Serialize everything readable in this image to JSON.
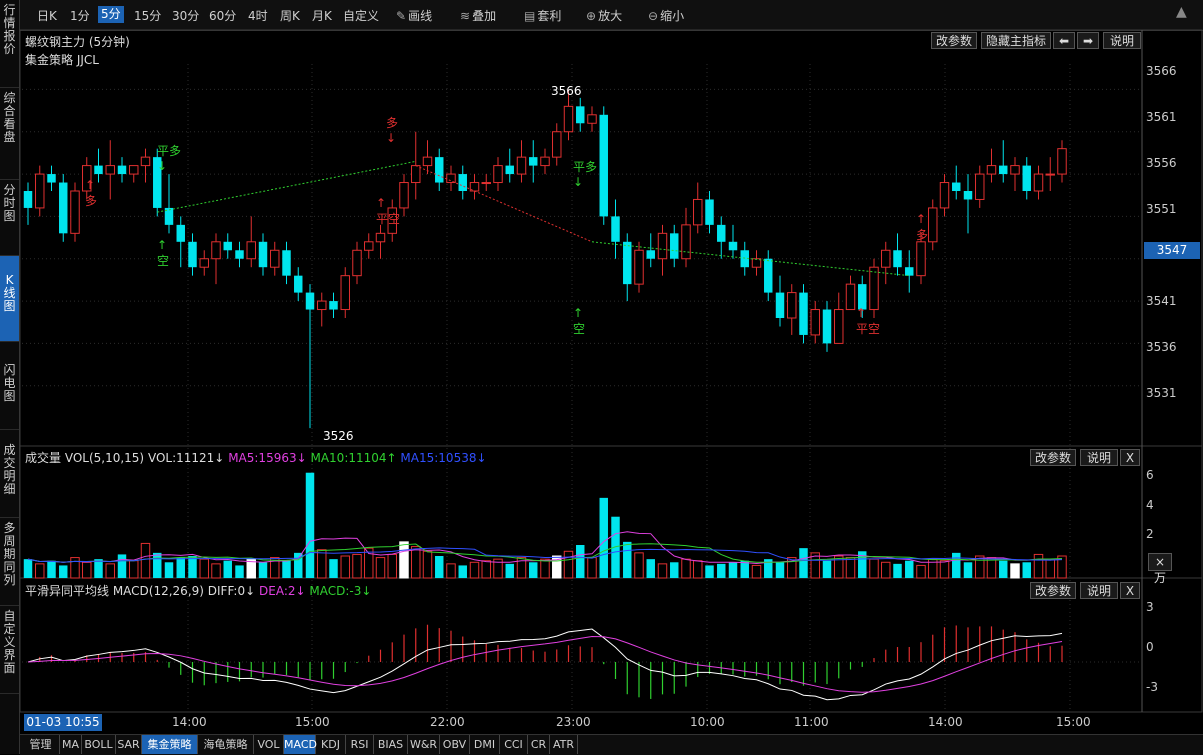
{
  "left_tabs": [
    {
      "label": "行情报价",
      "active": false
    },
    {
      "label": "综合看盘",
      "active": false
    },
    {
      "label": "分时图",
      "active": false
    },
    {
      "label": "K线图",
      "active": true
    },
    {
      "label": "闪电图",
      "active": false
    },
    {
      "label": "成交明细",
      "active": false
    },
    {
      "label": "多周期同列",
      "active": false
    },
    {
      "label": "自定义界面",
      "active": false
    }
  ],
  "toolbar": {
    "periods": [
      "日K",
      "1分",
      "5分",
      "15分",
      "30分",
      "60分",
      "4时",
      "周K",
      "月K",
      "自定义"
    ],
    "selected_period": "5分",
    "tools": [
      {
        "label": "画线",
        "icon": "pencil-icon"
      },
      {
        "label": "叠加",
        "icon": "stack-icon"
      },
      {
        "label": "套利",
        "icon": "arbitrage-icon"
      },
      {
        "label": "放大",
        "icon": "zoom-in-icon"
      },
      {
        "label": "缩小",
        "icon": "zoom-out-icon"
      }
    ]
  },
  "main_panel": {
    "title": "螺纹钢主力 (5分钟)",
    "strategy": "集金策略 JJCL",
    "buttons": {
      "params": "改参数",
      "hide": "隐藏主指标",
      "left": "⬅",
      "right": "➡",
      "help": "说明"
    },
    "high_label": "3566",
    "low_label": "3526",
    "current_price": "3547",
    "price_ticks": [
      "3566",
      "3561",
      "3556",
      "3551",
      "3541",
      "3536",
      "3531"
    ],
    "signals": [
      {
        "text": "多",
        "color": "#e03030"
      },
      {
        "text": "平多",
        "color": "#30d030"
      },
      {
        "text": "空",
        "color": "#30d030"
      },
      {
        "text": "多",
        "color": "#e03030"
      },
      {
        "text": "平空",
        "color": "#e03030"
      },
      {
        "text": "平多",
        "color": "#30d030"
      },
      {
        "text": "空",
        "color": "#30d030"
      },
      {
        "text": "平空",
        "color": "#e03030"
      },
      {
        "text": "多",
        "color": "#e03030"
      }
    ]
  },
  "vol_panel": {
    "title": "成交量 VOL(5,10,15)",
    "vol": "VOL:11121↓",
    "ma5": "MA5:15963↓",
    "ma10": "MA10:11104↑",
    "ma15": "MA15:10538↓",
    "ticks": [
      "6",
      "4",
      "2"
    ],
    "unit": "×万",
    "buttons": {
      "params": "改参数",
      "help": "说明",
      "close": "X"
    }
  },
  "macd_panel": {
    "title": "平滑异同平均线 MACD(12,26,9)",
    "diff": "DIFF:0↓",
    "dea": "DEA:2↓",
    "macd": "MACD:-3↓",
    "ticks": [
      "3",
      "0",
      "-3"
    ],
    "buttons": {
      "params": "改参数",
      "help": "说明",
      "close": "X"
    }
  },
  "time_axis": {
    "cursor": "01-03 10:55",
    "labels": [
      "14:00",
      "15:00",
      "22:00",
      "23:00",
      "10:00",
      "11:00",
      "14:00",
      "15:00"
    ]
  },
  "bottom_tabs": [
    "管理",
    "MA",
    "BOLL",
    "SAR",
    "集金策略",
    "海龟策略",
    "VOL",
    "MACD",
    "KDJ",
    "RSI",
    "BIAS",
    "W&R",
    "OBV",
    "DMI",
    "CCI",
    "CR",
    "ATR"
  ],
  "bottom_selected": [
    "集金策略",
    "MACD"
  ],
  "colors": {
    "up": "#e03030",
    "down": "#00e5ee",
    "accent": "#1c63b4",
    "ma5": "#e040e0",
    "ma10": "#30d030",
    "ma15": "#3050ff"
  },
  "chart_data": {
    "type": "candlestick",
    "price_range": [
      3524,
      3569
    ],
    "candles": [
      [
        3554,
        3555,
        3550,
        3552
      ],
      [
        3552,
        3557,
        3551,
        3556
      ],
      [
        3556,
        3557,
        3554,
        3555
      ],
      [
        3555,
        3556,
        3548,
        3549
      ],
      [
        3549,
        3555,
        3548,
        3554
      ],
      [
        3554,
        3558,
        3553,
        3557
      ],
      [
        3557,
        3559,
        3555,
        3556
      ],
      [
        3556,
        3560,
        3553,
        3557
      ],
      [
        3557,
        3558,
        3555,
        3556
      ],
      [
        3556,
        3557,
        3555,
        3557
      ],
      [
        3557,
        3559,
        3555,
        3558
      ],
      [
        3558,
        3559,
        3551,
        3552
      ],
      [
        3552,
        3556,
        3549,
        3550
      ],
      [
        3550,
        3551,
        3545,
        3548
      ],
      [
        3548,
        3549,
        3544,
        3545
      ],
      [
        3545,
        3547,
        3544,
        3546
      ],
      [
        3546,
        3549,
        3543,
        3548
      ],
      [
        3548,
        3549,
        3546,
        3547
      ],
      [
        3547,
        3548,
        3545,
        3546
      ],
      [
        3546,
        3551,
        3545,
        3548
      ],
      [
        3548,
        3549,
        3544,
        3545
      ],
      [
        3545,
        3548,
        3544,
        3547
      ],
      [
        3547,
        3548,
        3543,
        3544
      ],
      [
        3544,
        3545,
        3541,
        3542
      ],
      [
        3542,
        3543,
        3526,
        3540
      ],
      [
        3540,
        3542,
        3538,
        3541
      ],
      [
        3541,
        3542,
        3539,
        3540
      ],
      [
        3540,
        3545,
        3539,
        3544
      ],
      [
        3544,
        3548,
        3543,
        3547
      ],
      [
        3547,
        3549,
        3546,
        3548
      ],
      [
        3548,
        3550,
        3546,
        3549
      ],
      [
        3549,
        3553,
        3548,
        3552
      ],
      [
        3552,
        3556,
        3551,
        3555
      ],
      [
        3555,
        3561,
        3553,
        3557
      ],
      [
        3557,
        3560,
        3556,
        3558
      ],
      [
        3558,
        3559,
        3554,
        3555
      ],
      [
        3555,
        3557,
        3554,
        3556
      ],
      [
        3556,
        3557,
        3553,
        3554
      ],
      [
        3554,
        3556,
        3553,
        3555
      ],
      [
        3555,
        3556,
        3554,
        3555
      ],
      [
        3555,
        3558,
        3554,
        3557
      ],
      [
        3557,
        3559,
        3555,
        3556
      ],
      [
        3556,
        3560,
        3555,
        3558
      ],
      [
        3558,
        3560,
        3555,
        3557
      ],
      [
        3557,
        3559,
        3556,
        3558
      ],
      [
        3558,
        3562,
        3557,
        3561
      ],
      [
        3561,
        3566,
        3560,
        3564
      ],
      [
        3564,
        3565,
        3561,
        3562
      ],
      [
        3562,
        3564,
        3561,
        3563
      ],
      [
        3563,
        3564,
        3550,
        3551
      ],
      [
        3551,
        3553,
        3546,
        3548
      ],
      [
        3548,
        3549,
        3541,
        3543
      ],
      [
        3543,
        3548,
        3542,
        3547
      ],
      [
        3547,
        3549,
        3545,
        3546
      ],
      [
        3546,
        3550,
        3544,
        3549
      ],
      [
        3549,
        3550,
        3545,
        3546
      ],
      [
        3546,
        3552,
        3545,
        3550
      ],
      [
        3550,
        3555,
        3549,
        3553
      ],
      [
        3553,
        3554,
        3549,
        3550
      ],
      [
        3550,
        3551,
        3546,
        3548
      ],
      [
        3548,
        3550,
        3546,
        3547
      ],
      [
        3547,
        3548,
        3544,
        3545
      ],
      [
        3545,
        3547,
        3544,
        3546
      ],
      [
        3546,
        3547,
        3541,
        3542
      ],
      [
        3542,
        3544,
        3538,
        3539
      ],
      [
        3539,
        3543,
        3537,
        3542
      ],
      [
        3542,
        3543,
        3536,
        3537
      ],
      [
        3537,
        3541,
        3536,
        3540
      ],
      [
        3540,
        3541,
        3535,
        3536
      ],
      [
        3536,
        3542,
        3536,
        3540
      ],
      [
        3540,
        3544,
        3540,
        3543
      ],
      [
        3543,
        3544,
        3539,
        3540
      ],
      [
        3540,
        3546,
        3539,
        3545
      ],
      [
        3545,
        3548,
        3543,
        3547
      ],
      [
        3547,
        3549,
        3544,
        3545
      ],
      [
        3545,
        3547,
        3542,
        3544
      ],
      [
        3544,
        3549,
        3543,
        3548
      ],
      [
        3548,
        3553,
        3547,
        3552
      ],
      [
        3552,
        3556,
        3551,
        3555
      ],
      [
        3555,
        3557,
        3553,
        3554
      ],
      [
        3554,
        3556,
        3549,
        3553
      ],
      [
        3553,
        3557,
        3552,
        3556
      ],
      [
        3556,
        3559,
        3555,
        3557
      ],
      [
        3557,
        3560,
        3555,
        3556
      ],
      [
        3556,
        3558,
        3554,
        3557
      ],
      [
        3557,
        3558,
        3553,
        3554
      ],
      [
        3554,
        3557,
        3553,
        3556
      ],
      [
        3556,
        3558,
        3554,
        3556
      ],
      [
        3556,
        3560,
        3555,
        3559
      ]
    ],
    "volume": [
      1.2,
      0.9,
      1.1,
      0.8,
      1.3,
      1.0,
      1.2,
      0.9,
      1.5,
      1.1,
      2.2,
      1.6,
      1.0,
      1.3,
      1.4,
      1.2,
      0.9,
      1.1,
      0.8,
      1.2,
      1.0,
      1.3,
      1.1,
      1.6,
      6.7,
      1.8,
      1.2,
      1.4,
      1.5,
      1.9,
      1.3,
      1.5,
      2.3,
      2.0,
      1.7,
      1.4,
      0.9,
      0.8,
      1.0,
      1.1,
      1.2,
      0.9,
      1.3,
      1.0,
      1.2,
      1.4,
      1.7,
      2.1,
      1.3,
      5.1,
      3.9,
      2.3,
      1.6,
      1.2,
      0.9,
      1.0,
      1.2,
      1.1,
      0.8,
      0.9,
      1.0,
      1.1,
      0.8,
      1.2,
      1.0,
      1.3,
      1.9,
      1.6,
      1.1,
      1.4,
      1.3,
      1.7,
      1.2,
      1.0,
      0.9,
      1.1,
      0.8,
      1.2,
      1.1,
      1.6,
      1.0,
      1.4,
      1.3,
      1.1,
      0.9,
      1.0,
      1.5,
      1.2,
      1.4
    ],
    "volume_ylim": [
      0,
      7
    ]
  }
}
